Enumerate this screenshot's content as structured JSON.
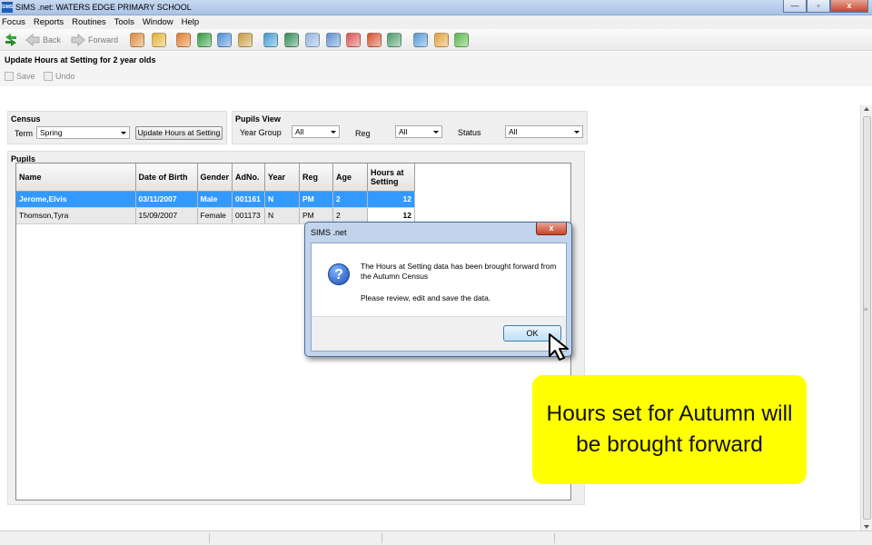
{
  "window": {
    "app_icon_text": "SIMS",
    "title": "SIMS .net: WATERS EDGE PRIMARY SCHOOL",
    "minimize": "—",
    "maximize": "▫",
    "close": "x"
  },
  "menu": [
    "Focus",
    "Reports",
    "Routines",
    "Tools",
    "Window",
    "Help"
  ],
  "toolbar": {
    "back_label": "Back",
    "forward_label": "Forward",
    "icon_colors": [
      "#d98b3a",
      "#e2b233",
      "#e07b28",
      "#2f9a3c",
      "#4a8bd6",
      "#c99a3d",
      "#3d9ad1",
      "#2e8b57",
      "#8fb4e0",
      "#5b8fd0",
      "#e05050",
      "#d64f2b",
      "#4a9d6b",
      "#5598d8",
      "#e3a13a",
      "#57b847"
    ]
  },
  "page": {
    "title": "Update Hours at Setting for 2 year olds",
    "save_label": "Save",
    "undo_label": "Undo"
  },
  "census": {
    "title": "Census",
    "term_label": "Term",
    "term_value": "Spring",
    "update_button": "Update Hours at Setting"
  },
  "pupils_view": {
    "title": "Pupils View",
    "year_group_label": "Year Group",
    "year_group_value": "All",
    "reg_label": "Reg",
    "reg_value": "All",
    "status_label": "Status",
    "status_value": "All"
  },
  "pupils": {
    "title": "Pupils",
    "columns": [
      "Name",
      "Date of Birth",
      "Gender",
      "AdNo.",
      "Year",
      "Reg",
      "Age",
      "Hours at Setting"
    ],
    "rows": [
      {
        "name": "Jerome,Elvis",
        "dob": "03/11/2007",
        "gender": "Male",
        "adno": "001161",
        "year": "N",
        "reg": "PM",
        "age": "2",
        "hours": "12"
      },
      {
        "name": "Thomson,Tyra",
        "dob": "15/09/2007",
        "gender": "Female",
        "adno": "001173",
        "year": "N",
        "reg": "PM",
        "age": "2",
        "hours": "12"
      }
    ]
  },
  "dialog": {
    "title": "SIMS .net",
    "close": "x",
    "icon": "?",
    "message": "The Hours at Setting data has been brought forward from the Autumn Census",
    "message2": "Please review, edit and save the data.",
    "ok_label": "OK"
  },
  "callout": {
    "text": "Hours set for Autumn will be brought forward"
  }
}
